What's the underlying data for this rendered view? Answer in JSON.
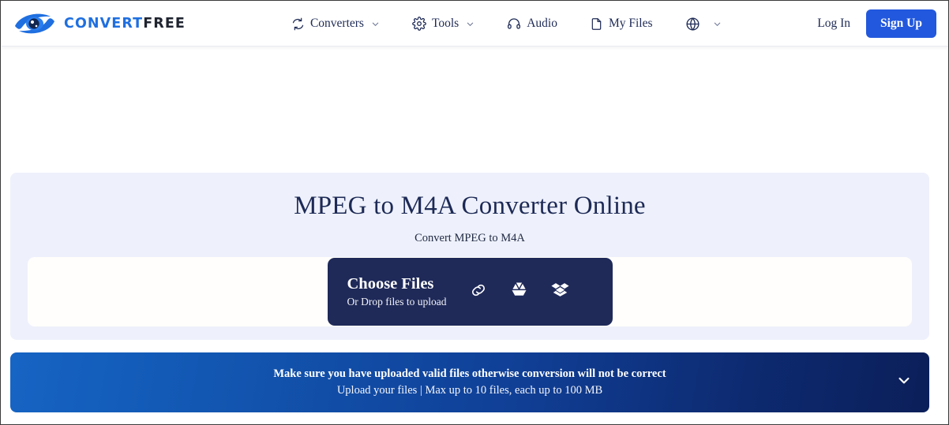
{
  "header": {
    "logo": {
      "icon": "eye-swoosh-logo-icon",
      "text_primary": "CONVERT",
      "text_secondary": "FREE"
    },
    "nav": [
      {
        "label": "Converters",
        "icon": "sync-arrows-icon",
        "has_chevron": true
      },
      {
        "label": "Tools",
        "icon": "gear-icon",
        "has_chevron": true
      },
      {
        "label": "Audio",
        "icon": "headphones-icon",
        "has_chevron": false
      },
      {
        "label": "My Files",
        "icon": "document-icon",
        "has_chevron": false
      },
      {
        "label": "",
        "icon": "globe-icon",
        "has_chevron": true
      }
    ],
    "login_label": "Log In",
    "signup_label": "Sign Up",
    "accent_color": "#2258dd"
  },
  "hero": {
    "title": "MPEG to M4A Converter Online",
    "subtitle": "Convert MPEG to M4A",
    "background_color": "#eef1fb",
    "title_color": "#1d2a56",
    "dropzone": {
      "choose_label": "Choose Files",
      "drop_label": "Or Drop files to upload",
      "button_color": "#1f2a59",
      "sources": [
        {
          "name": "link-icon"
        },
        {
          "name": "google-drive-icon"
        },
        {
          "name": "dropbox-icon"
        }
      ]
    }
  },
  "banner": {
    "line1": "Make sure you have uploaded valid files otherwise conversion will not be correct",
    "line2": "Upload your files | Max up to 10 files, each up to 100 MB",
    "toggle_icon": "chevron-down-icon",
    "gradient_from": "#1664c4",
    "gradient_to": "#0b1f59"
  }
}
